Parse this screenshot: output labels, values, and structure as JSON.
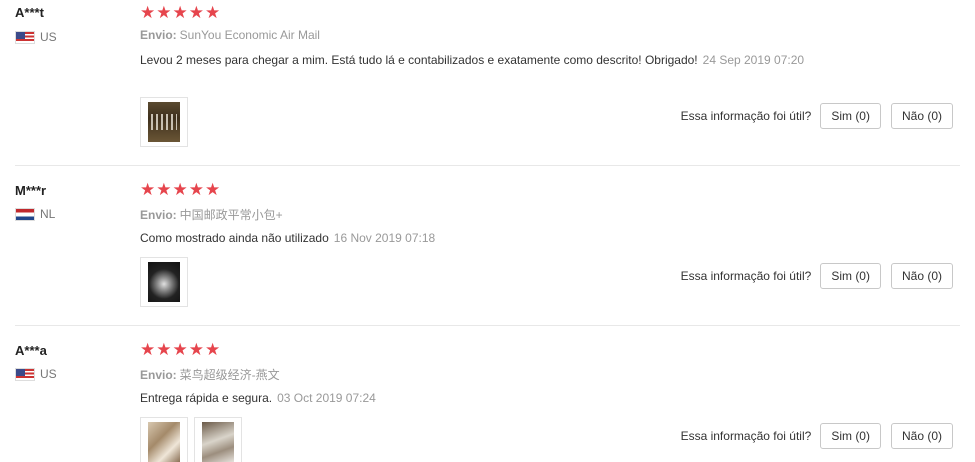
{
  "rating_stars": "★★★★★",
  "star_color": "#e6454d",
  "reviews": [
    {
      "user": "A***t",
      "country": "US",
      "flag": "us-flag-icon",
      "ship_label": "Envio:",
      "ship_method": "SunYou Economic Air Mail",
      "comment": "Levou 2 meses para chegar a mim. Está tudo lá e contabilizados e exatamente como descrito! Obrigado!",
      "date": "24 Sep 2019 07:20",
      "helpful_question": "Essa informação foi útil?",
      "yes_label": "Sim (0)",
      "no_label": "Não (0)"
    },
    {
      "user": "M***r",
      "country": "NL",
      "flag": "nl-flag-icon",
      "ship_label": "Envio:",
      "ship_method": "中国邮政平常小包+",
      "comment": "Como mostrado ainda não utilizado",
      "date": "16 Nov 2019 07:18",
      "helpful_question": "Essa informação foi útil?",
      "yes_label": "Sim (0)",
      "no_label": "Não (0)"
    },
    {
      "user": "A***a",
      "country": "US",
      "flag": "us-flag-icon",
      "ship_label": "Envio:",
      "ship_method": "菜鸟超级经济-燕文",
      "comment": "Entrega rápida e segura.",
      "date": "03 Oct 2019 07:24",
      "helpful_question": "Essa informação foi útil?",
      "yes_label": "Sim (0)",
      "no_label": "Não (0)"
    }
  ]
}
